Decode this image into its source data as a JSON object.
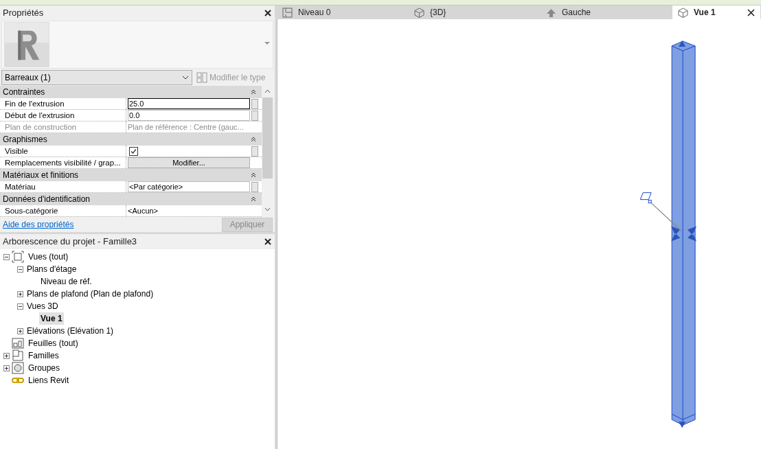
{
  "properties_panel": {
    "title": "Propriétés",
    "type_selector": {
      "value": "Barreaux (1)"
    },
    "edit_type_button": {
      "label": "Modifier le type",
      "disabled": true
    },
    "rows": [
      {
        "kind": "group",
        "label": "Contraintes",
        "expanded": true
      },
      {
        "kind": "input",
        "label": "Fin de l'extrusion",
        "value": "25.0",
        "disabled": false
      },
      {
        "kind": "input",
        "label": "Début de l'extrusion",
        "value": "0.0",
        "disabled": false
      },
      {
        "kind": "text",
        "label": "Plan de construction",
        "value": "Plan de référence : Centre (gauc...",
        "disabled": true
      },
      {
        "kind": "group",
        "label": "Graphismes",
        "expanded": true
      },
      {
        "kind": "checkbox",
        "label": "Visible",
        "checked": true,
        "disabled": false
      },
      {
        "kind": "button",
        "label": "Remplacements visibilité / grap...",
        "value": "Modifier...",
        "disabled": false
      },
      {
        "kind": "group",
        "label": "Matériaux et finitions",
        "expanded": true
      },
      {
        "kind": "input",
        "label": "Matériau",
        "value": "<Par catégorie>",
        "disabled": false
      },
      {
        "kind": "group",
        "label": "Données d'identification",
        "expanded": true
      },
      {
        "kind": "text",
        "label": "Sous-catégorie",
        "value": "<Aucun>",
        "disabled": false
      }
    ],
    "help_link": "Aide des propriétés",
    "apply_button": {
      "label": "Appliquer",
      "disabled": true
    }
  },
  "project_browser": {
    "title": "Arborescence du projet - Famille3",
    "tree": [
      {
        "label": "Vues (tout)",
        "kind": "views",
        "expanded": true,
        "selected": false,
        "children": [
          {
            "label": "Plans d'étage",
            "expanded": true,
            "selected": false,
            "children": [
              {
                "label": "Niveau de réf.",
                "selected": false
              }
            ]
          },
          {
            "label": "Plans de plafond (Plan de plafond)",
            "expanded": false,
            "selected": false
          },
          {
            "label": "Vues 3D",
            "expanded": true,
            "selected": false,
            "children": [
              {
                "label": "Vue 1",
                "selected": true
              }
            ]
          },
          {
            "label": "Elévations (Elévation 1)",
            "expanded": false,
            "selected": false
          }
        ]
      },
      {
        "label": "Feuilles (tout)",
        "kind": "sheets",
        "selected": false
      },
      {
        "label": "Familles",
        "kind": "families",
        "expanded": false,
        "selected": false
      },
      {
        "label": "Groupes",
        "kind": "groups",
        "expanded": false,
        "selected": false
      },
      {
        "label": "Liens Revit",
        "kind": "links",
        "selected": false
      }
    ]
  },
  "view_tabs": [
    {
      "label": "Niveau 0",
      "kind": "plan",
      "selected": false
    },
    {
      "label": "{3D}",
      "kind": "cube",
      "selected": false
    },
    {
      "label": "Gauche",
      "kind": "elevation",
      "selected": false
    },
    {
      "label": "Vue 1",
      "kind": "cube",
      "selected": true
    }
  ]
}
